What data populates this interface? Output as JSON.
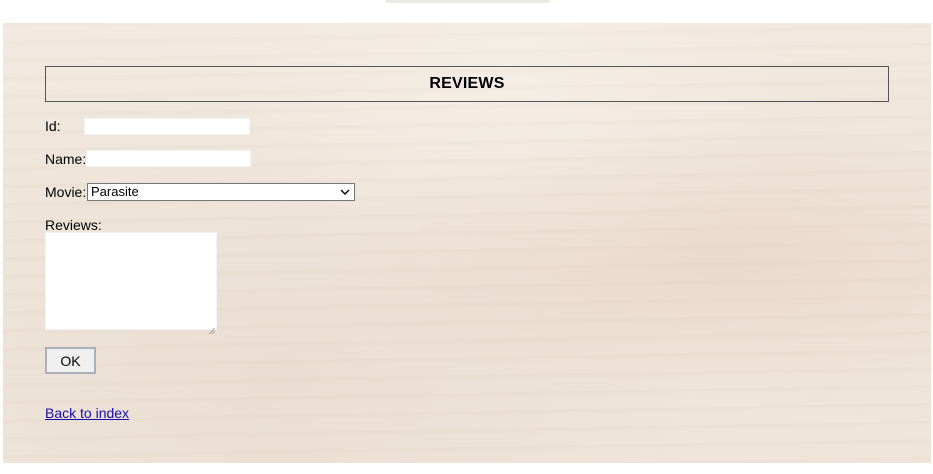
{
  "form": {
    "title": "REVIEWS",
    "id_label": "Id:",
    "id_value": "",
    "name_label": "Name:",
    "name_value": "",
    "movie_label": "Movie:",
    "movie_selected": "Parasite",
    "reviews_label": "Reviews:",
    "reviews_value": "",
    "ok_label": "OK"
  },
  "footer": {
    "back_link": "Back to index"
  },
  "icons": {
    "select_arrow": "chevron-down-icon",
    "textarea_resize": "resize-grip-icon"
  },
  "colors": {
    "panel_background": "#efe5da",
    "link": "#1a0dab"
  }
}
